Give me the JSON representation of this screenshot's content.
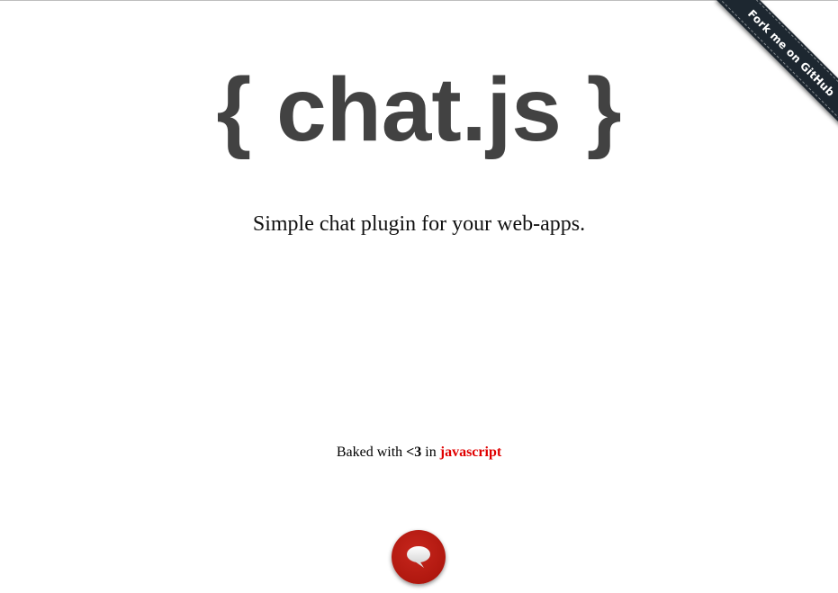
{
  "ribbon": {
    "label": "Fork me on GitHub"
  },
  "hero": {
    "title": "{ chat.js }",
    "tagline": "Simple chat plugin for your web-apps."
  },
  "footer": {
    "prefix": "Baked with",
    "heart": "<3",
    "middle": "in",
    "language": "javascript"
  },
  "chat_button": {
    "icon": "speech-bubble-icon"
  },
  "colors": {
    "title": "#424242",
    "accent_red": "#e00000",
    "chat_button": "#b0180f",
    "ribbon": "#1d2730"
  }
}
